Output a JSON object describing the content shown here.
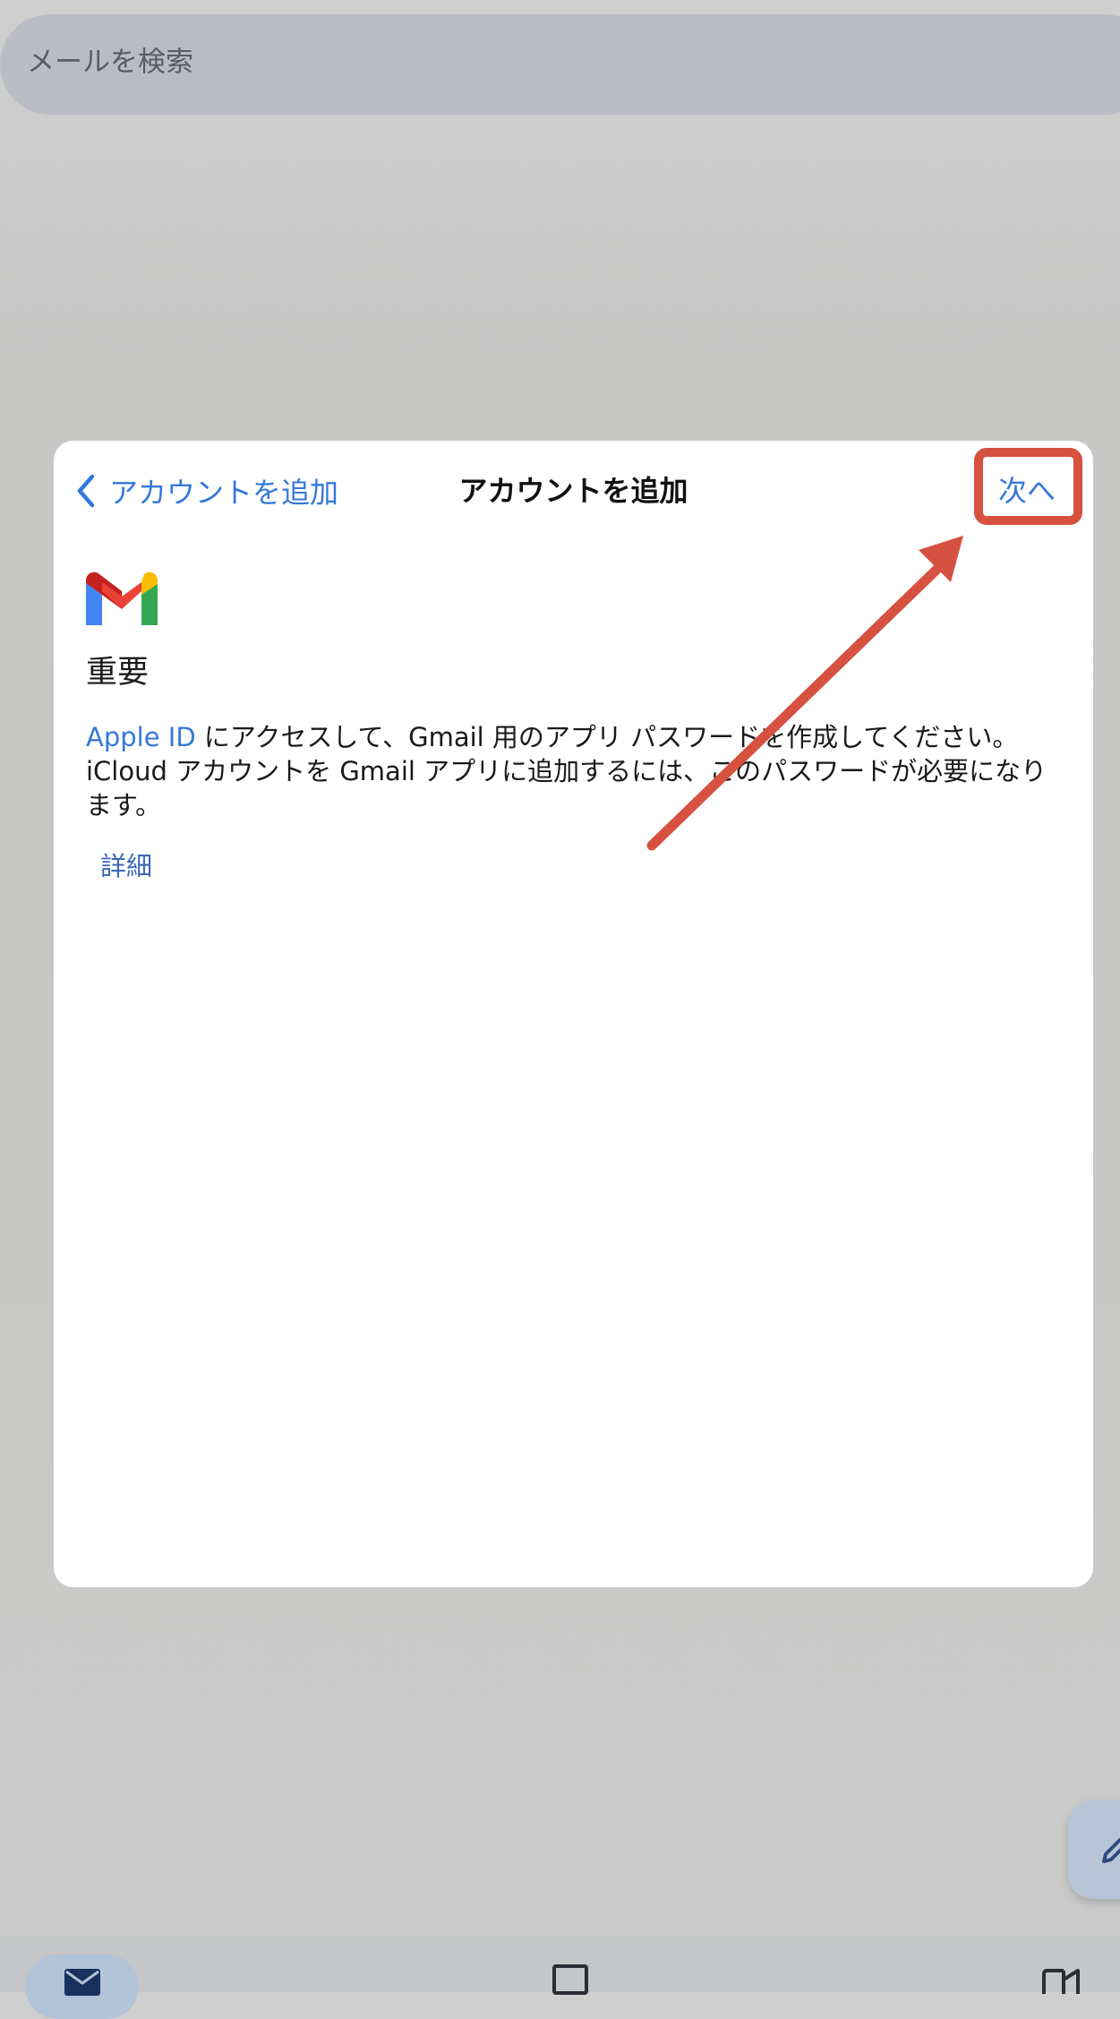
{
  "search": {
    "placeholder": "メールを検索"
  },
  "sheet": {
    "back_label": "アカウントを追加",
    "title": "アカウントを追加",
    "next_label": "次へ",
    "heading": "重要",
    "body": {
      "link_text": "Apple ID",
      "text": " にアクセスして、Gmail 用のアプリ パスワードを作成してください。iCloud アカウントを Gmail アプリに追加するには、このパスワードが必要になります。"
    },
    "details_label": "詳細"
  },
  "colors": {
    "link": "#3478d9",
    "annotation": "#d65140",
    "search_bar": "#b9bcc3",
    "nav_active": "#b3c3d8"
  },
  "icons": {
    "back": "chevron-left-icon",
    "logo": "gmail-logo-icon",
    "compose": "pencil-icon",
    "nav_mail": "mail-icon",
    "nav_chat": "chat-icon",
    "nav_meet": "video-icon"
  },
  "bottom_nav": {
    "items": [
      "mail",
      "chat",
      "meet"
    ],
    "active": "mail"
  }
}
